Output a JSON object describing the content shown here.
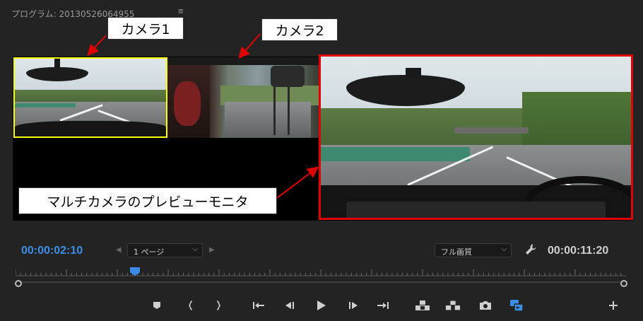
{
  "panel": {
    "title": "プログラム: 20130526064955",
    "menu_icon": "≡"
  },
  "callouts": {
    "camera1": "カメラ1",
    "camera2": "カメラ2",
    "preview": "マルチカメラのプレビューモニタ"
  },
  "colors": {
    "camera1_border": "#ffff00",
    "preview_border": "#e00000",
    "accent_blue": "#3d8ee6",
    "arrow": "#e00000"
  },
  "controls": {
    "current_timecode": "00:00:02:10",
    "page_select": "1 ページ",
    "quality_select": "フル画質",
    "duration_timecode": "00:00:11:20"
  },
  "icons": {
    "page_prev": "◀",
    "page_next": "▶",
    "chevron": "⌵",
    "wrench": "wrench-icon"
  },
  "transport": [
    {
      "name": "add-marker-button",
      "icon": "marker-icon"
    },
    {
      "name": "mark-in-button",
      "icon": "mark-in-icon"
    },
    {
      "name": "mark-out-button",
      "icon": "mark-out-icon"
    },
    {
      "name": "go-to-in-button",
      "icon": "go-to-in-icon"
    },
    {
      "name": "step-back-button",
      "icon": "step-back-icon"
    },
    {
      "name": "play-button",
      "icon": "play-icon"
    },
    {
      "name": "step-forward-button",
      "icon": "step-forward-icon"
    },
    {
      "name": "go-to-out-button",
      "icon": "go-to-out-icon"
    },
    {
      "name": "lift-button",
      "icon": "lift-icon"
    },
    {
      "name": "extract-button",
      "icon": "extract-icon"
    },
    {
      "name": "export-frame-button",
      "icon": "camera-icon"
    },
    {
      "name": "toggle-multicam-button",
      "icon": "multicam-icon"
    },
    {
      "name": "button-editor-button",
      "icon": "plus-icon"
    }
  ]
}
